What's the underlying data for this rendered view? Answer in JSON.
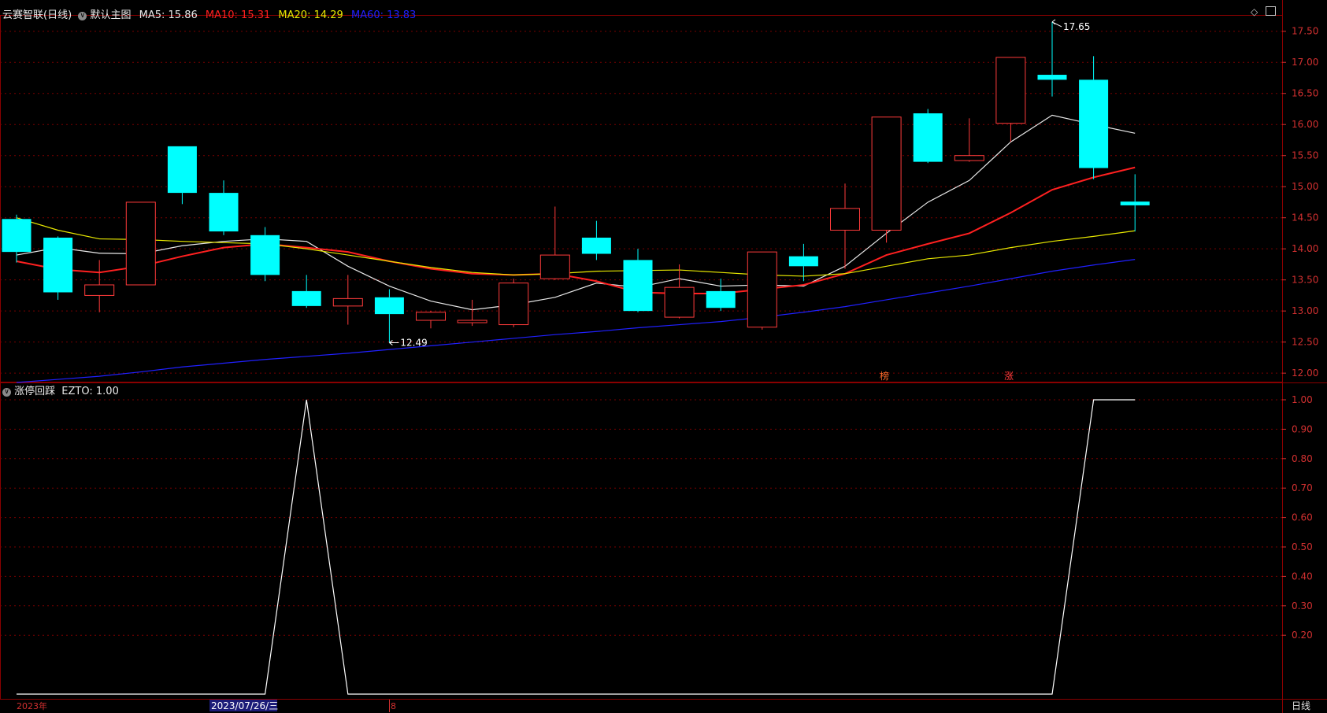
{
  "main_panel": {
    "stock_name": "云赛智联",
    "period": "(日线)",
    "template": "默认主图",
    "ma": [
      {
        "label": "MA5",
        "value": "15.86",
        "color": "#e8e8e8"
      },
      {
        "label": "MA10",
        "value": "15.31",
        "color": "#ff2020"
      },
      {
        "label": "MA20",
        "value": "14.29",
        "color": "#e8e800"
      },
      {
        "label": "MA60",
        "value": "13.83",
        "color": "#2020ff"
      }
    ],
    "high_label": "17.65",
    "low_label": "12.49",
    "badges": [
      "榜",
      "涨"
    ]
  },
  "sub_panel": {
    "indicator_name": "涨停回踩",
    "line_label": "EZTO",
    "line_value": "1.00"
  },
  "bottom_bar": {
    "year_label": "2023年",
    "cursor_date": "2023/07/26/三",
    "month_label": "8",
    "period_button": "日线"
  },
  "colors": {
    "up": "#ff3b3b",
    "down": "#00ffff",
    "grid": "#7a0000",
    "axis_text": "#d23030"
  },
  "icons": [
    "collapse-icon",
    "diamond-icon",
    "panel-toggle-icon"
  ],
  "chart_data": [
    {
      "type": "candlestick",
      "y_ticks": [
        12.0,
        12.5,
        13.0,
        13.5,
        14.0,
        14.5,
        15.0,
        15.5,
        16.0,
        16.5,
        17.0,
        17.5
      ],
      "ylim": [
        11.85,
        17.75
      ],
      "candles": [
        {
          "o": 14.48,
          "h": 14.55,
          "l": 13.78,
          "c": 13.95
        },
        {
          "o": 14.18,
          "h": 14.2,
          "l": 13.18,
          "c": 13.3
        },
        {
          "o": 13.25,
          "h": 13.82,
          "l": 12.98,
          "c": 13.42
        },
        {
          "o": 13.42,
          "h": 14.75,
          "l": 13.42,
          "c": 14.75
        },
        {
          "o": 15.65,
          "h": 15.65,
          "l": 14.72,
          "c": 14.9
        },
        {
          "o": 14.9,
          "h": 15.1,
          "l": 14.22,
          "c": 14.28
        },
        {
          "o": 14.22,
          "h": 14.35,
          "l": 13.48,
          "c": 13.58
        },
        {
          "o": 13.32,
          "h": 13.58,
          "l": 13.05,
          "c": 13.08
        },
        {
          "o": 13.08,
          "h": 13.58,
          "l": 12.78,
          "c": 13.2
        },
        {
          "o": 13.22,
          "h": 13.35,
          "l": 12.49,
          "c": 12.95
        },
        {
          "o": 12.85,
          "h": 13.0,
          "l": 12.72,
          "c": 12.98
        },
        {
          "o": 12.82,
          "h": 13.18,
          "l": 12.76,
          "c": 12.85
        },
        {
          "o": 12.78,
          "h": 13.52,
          "l": 12.74,
          "c": 13.45
        },
        {
          "o": 13.52,
          "h": 14.68,
          "l": 13.5,
          "c": 13.9
        },
        {
          "o": 14.18,
          "h": 14.45,
          "l": 13.82,
          "c": 13.92
        },
        {
          "o": 13.82,
          "h": 14.0,
          "l": 12.98,
          "c": 13.0
        },
        {
          "o": 12.9,
          "h": 13.75,
          "l": 12.88,
          "c": 13.38
        },
        {
          "o": 13.32,
          "h": 13.52,
          "l": 13.0,
          "c": 13.05
        },
        {
          "o": 12.74,
          "h": 13.95,
          "l": 12.7,
          "c": 13.95
        },
        {
          "o": 13.88,
          "h": 14.08,
          "l": 13.48,
          "c": 13.72
        },
        {
          "o": 14.3,
          "h": 15.05,
          "l": 13.68,
          "c": 14.65
        },
        {
          "o": 14.3,
          "h": 16.12,
          "l": 14.1,
          "c": 16.12
        },
        {
          "o": 16.18,
          "h": 16.25,
          "l": 15.38,
          "c": 15.4
        },
        {
          "o": 15.42,
          "h": 16.1,
          "l": 15.4,
          "c": 15.5
        },
        {
          "o": 16.02,
          "h": 17.08,
          "l": 15.72,
          "c": 17.08
        },
        {
          "o": 16.8,
          "h": 17.65,
          "l": 16.45,
          "c": 16.72
        },
        {
          "o": 16.72,
          "h": 17.1,
          "l": 15.12,
          "c": 15.3
        },
        {
          "o": 14.76,
          "h": 15.2,
          "l": 14.28,
          "c": 14.7
        }
      ],
      "ma_series": [
        {
          "name": "MA5",
          "color": "#e8e8e8",
          "values": [
            13.9,
            14.02,
            13.93,
            13.92,
            14.05,
            14.12,
            14.16,
            14.12,
            13.72,
            13.4,
            13.16,
            13.02,
            13.1,
            13.22,
            13.45,
            13.38,
            13.52,
            13.4,
            13.42,
            13.4,
            13.72,
            14.25,
            14.75,
            15.1,
            15.72,
            16.15,
            16.0,
            15.86
          ]
        },
        {
          "name": "MA10",
          "color": "#ff2020",
          "values": [
            13.8,
            13.67,
            13.62,
            13.72,
            13.88,
            14.02,
            14.08,
            14.02,
            13.95,
            13.8,
            13.68,
            13.6,
            13.58,
            13.6,
            13.48,
            13.3,
            13.28,
            13.28,
            13.35,
            13.42,
            13.6,
            13.9,
            14.08,
            14.25,
            14.58,
            14.95,
            15.15,
            15.31
          ]
        },
        {
          "name": "MA20",
          "color": "#e8e800",
          "values": [
            14.5,
            14.3,
            14.16,
            14.15,
            14.12,
            14.1,
            14.08,
            14.0,
            13.9,
            13.8,
            13.7,
            13.62,
            13.58,
            13.6,
            13.64,
            13.65,
            13.66,
            13.62,
            13.58,
            13.56,
            13.6,
            13.72,
            13.84,
            13.9,
            14.02,
            14.12,
            14.2,
            14.29
          ]
        },
        {
          "name": "MA60",
          "color": "#2020ff",
          "values": [
            11.85,
            11.9,
            11.95,
            12.02,
            12.1,
            12.16,
            12.22,
            12.27,
            12.32,
            12.38,
            12.44,
            12.5,
            12.56,
            12.62,
            12.67,
            12.73,
            12.78,
            12.83,
            12.9,
            12.98,
            13.07,
            13.18,
            13.29,
            13.4,
            13.52,
            13.64,
            13.74,
            13.83
          ]
        }
      ]
    },
    {
      "type": "line",
      "name": "EZTO",
      "y_ticks": [
        0.2,
        0.3,
        0.4,
        0.5,
        0.6,
        0.7,
        0.8,
        0.9,
        1.0
      ],
      "ylim": [
        0.0,
        1.0
      ],
      "values": [
        0,
        0,
        0,
        0,
        0,
        0,
        0,
        1,
        0,
        0,
        0,
        0,
        0,
        0,
        0,
        0,
        0,
        0,
        0,
        0,
        0,
        0,
        0,
        0,
        0,
        0,
        1,
        1
      ]
    }
  ]
}
